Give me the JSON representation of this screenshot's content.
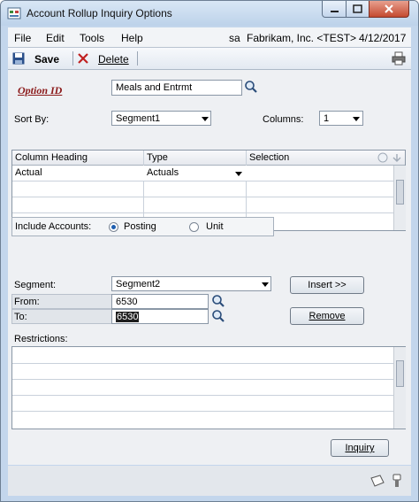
{
  "window": {
    "title": "Account Rollup Inquiry Options"
  },
  "menu": {
    "items": [
      "File",
      "Edit",
      "Tools",
      "Help"
    ]
  },
  "context": {
    "user": "sa",
    "company": "Fabrikam, Inc. <TEST>",
    "date": "4/12/2017"
  },
  "toolbar": {
    "save_label": "Save",
    "delete_label": "Delete"
  },
  "form": {
    "option_id_label": "Option ID",
    "option_id_value": "Meals and Entrmt",
    "sort_by_label": "Sort By:",
    "sort_by_value": "Segment1",
    "columns_label": "Columns:",
    "columns_value": "1"
  },
  "grid": {
    "headers": [
      "Column Heading",
      "Type",
      "Selection"
    ],
    "rows": [
      [
        "Actual",
        "Actuals",
        ""
      ],
      [
        "",
        "",
        ""
      ],
      [
        "",
        "",
        ""
      ],
      [
        "",
        "",
        ""
      ]
    ]
  },
  "include": {
    "label": "Include Accounts:",
    "options": [
      "Posting",
      "Unit"
    ],
    "selected": "Posting"
  },
  "segment": {
    "label": "Segment:",
    "value": "Segment2",
    "from_label": "From:",
    "from_value": "6530",
    "to_label": "To:",
    "to_value": "6530",
    "insert_label": "Insert >>",
    "remove_label": "Remove"
  },
  "restrictions": {
    "label": "Restrictions:",
    "rows": [
      "",
      "",
      "",
      "",
      ""
    ]
  },
  "buttons": {
    "inquiry_label": "Inquiry"
  },
  "colors": {
    "title_bar": "#c3d6ec",
    "option_id_label": "#8b1a1a",
    "close_button": "#c44a30"
  }
}
